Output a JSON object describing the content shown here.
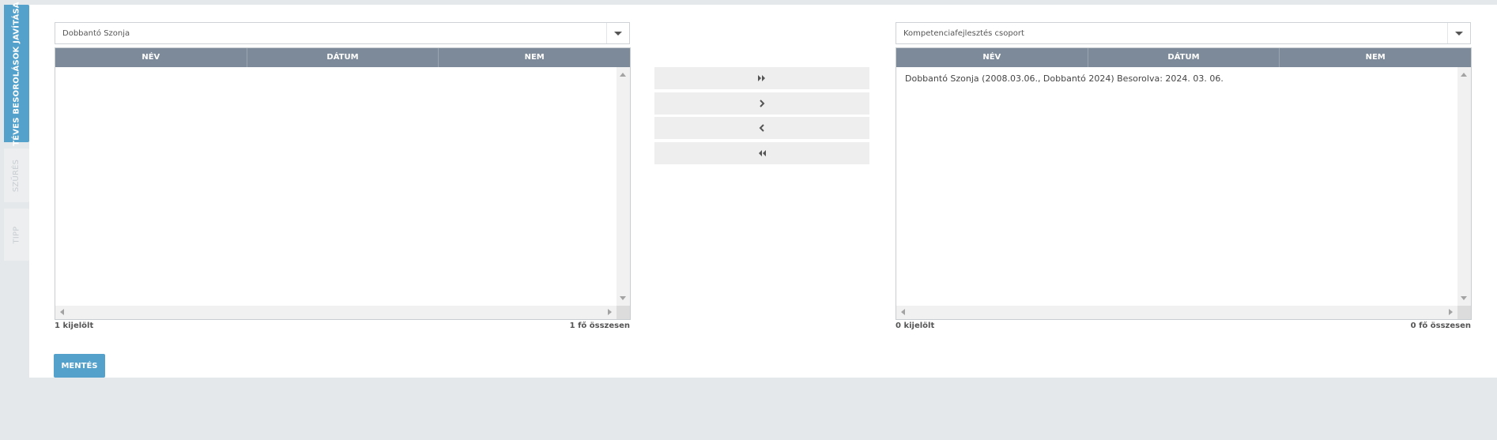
{
  "side_tabs": [
    {
      "label": "TÉVES BESOROLÁSOK JAVÍTÁSA",
      "active": true
    },
    {
      "label": "SZŰRÉS",
      "active": false
    },
    {
      "label": "TIPP",
      "active": false
    }
  ],
  "left_list": {
    "dropdown_value": "Dobbantó Szonja",
    "columns": [
      "NÉV",
      "DÁTUM",
      "NEM"
    ],
    "rows": [],
    "selected_count": "1 kijelölt",
    "total_count": "1 fő összesen"
  },
  "right_list": {
    "dropdown_value": "Kompetenciafejlesztés csoport",
    "columns": [
      "NÉV",
      "DÁTUM",
      "NEM"
    ],
    "rows": [
      "Dobbantó Szonja (2008.03.06., Dobbantó 2024) Besorolva: 2024. 03. 06."
    ],
    "selected_count": "0 kijelölt",
    "total_count": "0 fő összesen"
  },
  "move_buttons": {
    "all_right_icon": "double-chevron-right-icon",
    "one_right_icon": "chevron-right-icon",
    "one_left_icon": "chevron-left-icon",
    "all_left_icon": "double-chevron-left-icon"
  },
  "save_label": "MENTÉS",
  "colors": {
    "accent": "#54a1cc",
    "table_header": "#7c8a99",
    "background": "#e5e8eb"
  }
}
